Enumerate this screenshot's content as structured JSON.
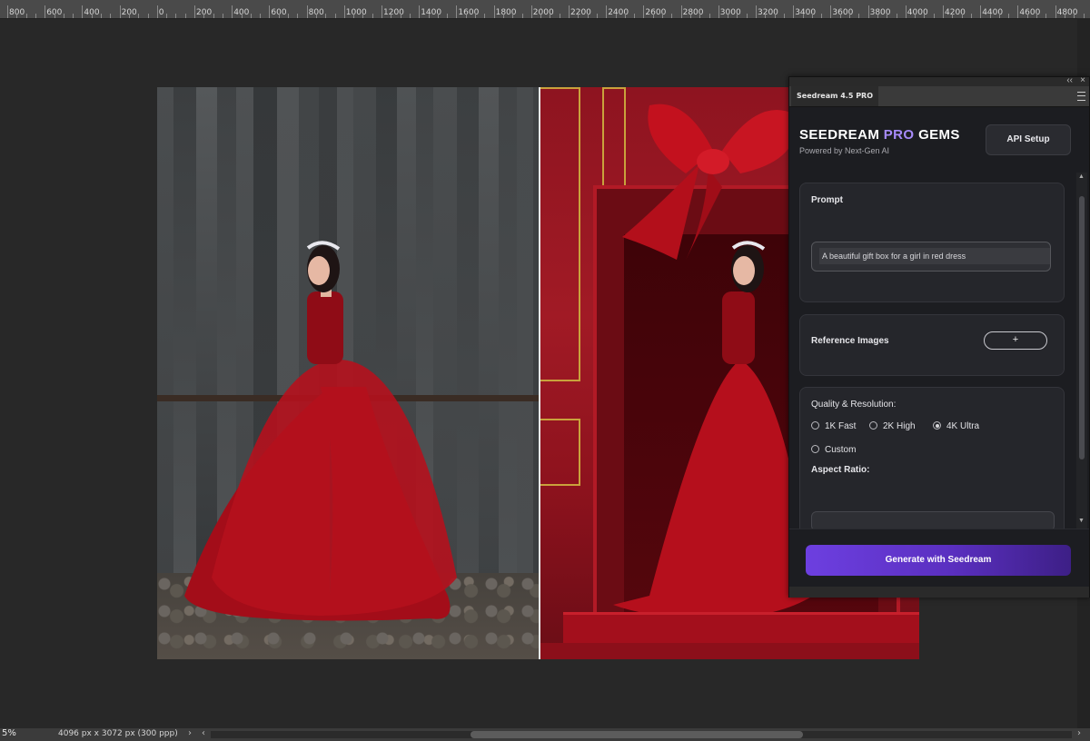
{
  "ruler": {
    "labels": [
      "800",
      "600",
      "400",
      "200",
      "0",
      "200",
      "400",
      "600",
      "800",
      "1000",
      "1200",
      "1400",
      "1600",
      "1800",
      "2000",
      "2200",
      "2400",
      "2600",
      "2800",
      "3000",
      "3200",
      "3400",
      "3600",
      "3800",
      "4000",
      "4200",
      "4400",
      "4600",
      "4800"
    ]
  },
  "panel": {
    "tab_label": "Seedream 4.5 PRO",
    "collapse_glyph": "‹‹",
    "close_glyph": "×",
    "brand": {
      "part1": "SEEDREAM ",
      "part2": "PRO",
      "part3": " GEMS",
      "subtitle": "Powered by Next-Gen AI",
      "accent_color": "#a78bfa"
    },
    "api_button": "API Setup",
    "prompt": {
      "title": "Prompt",
      "value": "A beautiful gift box for a girl in red dress"
    },
    "reference": {
      "title": "Reference Images",
      "add_label": "+"
    },
    "quality": {
      "title": "Quality & Resolution:",
      "options": [
        {
          "label": "1K Fast",
          "selected": false
        },
        {
          "label": "2K High",
          "selected": false
        },
        {
          "label": "4K Ultra",
          "selected": true
        },
        {
          "label": "Custom",
          "selected": false
        }
      ],
      "aspect_title": "Aspect Ratio:"
    },
    "generate_button": "Generate with Seedream",
    "generate_gradient": [
      "#6d3fe0",
      "#3d1f86"
    ]
  },
  "statusbar": {
    "zoom": "5%",
    "dimensions": "4096 px x 3072 px (300 ppp)",
    "arrow_right": "›",
    "arrow_left": "‹"
  }
}
